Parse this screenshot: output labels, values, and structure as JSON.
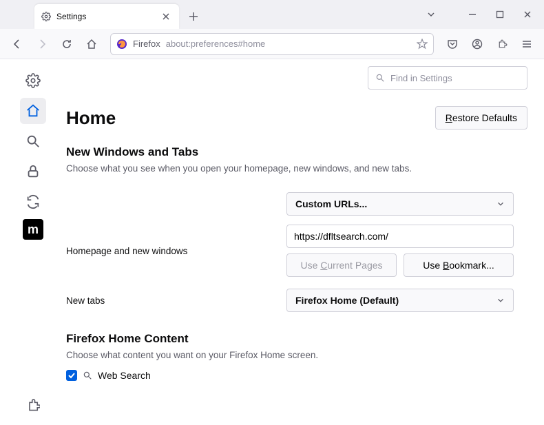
{
  "window": {
    "tab_title": "Settings"
  },
  "toolbar": {
    "identity_label": "Firefox",
    "url": "about:preferences#home"
  },
  "search": {
    "placeholder": "Find in Settings"
  },
  "page": {
    "title": "Home",
    "restore_label": "Restore Defaults",
    "section1": {
      "heading": "New Windows and Tabs",
      "subtext": "Choose what you see when you open your homepage, new windows, and new tabs.",
      "homepage_label": "Homepage and new windows",
      "homepage_select": "Custom URLs...",
      "homepage_url": "https://dfltsearch.com/",
      "use_current_label": "Use Current Pages",
      "use_bookmark_label": "Use Bookmark...",
      "newtabs_label": "New tabs",
      "newtabs_select": "Firefox Home (Default)"
    },
    "section2": {
      "heading": "Firefox Home Content",
      "subtext": "Choose what content you want on your Firefox Home screen.",
      "websearch_label": "Web Search"
    }
  }
}
